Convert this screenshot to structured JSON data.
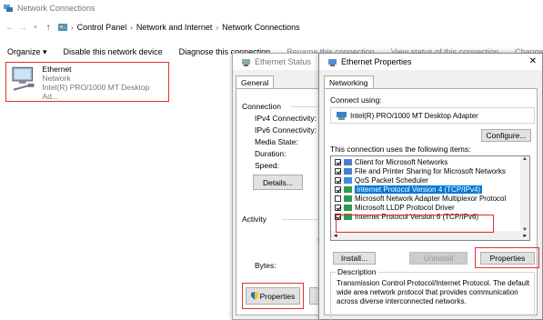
{
  "window": {
    "title": "Network Connections"
  },
  "address": {
    "crumbs": [
      "Control Panel",
      "Network and Internet",
      "Network Connections"
    ]
  },
  "command_bar": {
    "organize": "Organize ▾",
    "disable": "Disable this network device",
    "diagnose": "Diagnose this connection",
    "rename": "Rename this connection",
    "view_status": "View status of this connection",
    "change": "Change settings of this connection"
  },
  "adapter": {
    "name": "Ethernet",
    "network": "Network",
    "device": "Intel(R) PRO/1000 MT Desktop Ad..."
  },
  "status_dialog": {
    "title": "Ethernet Status",
    "tab": "General",
    "connection_label": "Connection",
    "ipv4": "IPv4 Connectivity:",
    "ipv6": "IPv6 Connectivity:",
    "media": "Media State:",
    "duration": "Duration:",
    "speed": "Speed:",
    "details_btn": "Details...",
    "activity_label": "Activity",
    "s_char": "S",
    "bytes": "Bytes:",
    "properties_btn": "Properties"
  },
  "props_dialog": {
    "title": "Ethernet Properties",
    "close": "✕",
    "tab": "Networking",
    "connect_using": "Connect using:",
    "adapter_name": "Intel(R) PRO/1000 MT Desktop Adapter",
    "configure_btn": "Configure...",
    "items_label": "This connection uses the following items:",
    "items": [
      {
        "label": "Client for Microsoft Networks",
        "checked": true,
        "selected": false
      },
      {
        "label": "File and Printer Sharing for Microsoft Networks",
        "checked": true,
        "selected": false
      },
      {
        "label": "QoS Packet Scheduler",
        "checked": true,
        "selected": false
      },
      {
        "label": "Internet Protocol Version 4 (TCP/IPv4)",
        "checked": true,
        "selected": true
      },
      {
        "label": "Microsoft Network Adapter Multiplexor Protocol",
        "checked": false,
        "selected": false
      },
      {
        "label": "Microsoft LLDP Protocol Driver",
        "checked": true,
        "selected": false
      },
      {
        "label": "Internet Protocol Version 6 (TCP/IPv6)",
        "checked": true,
        "selected": false
      }
    ],
    "install_btn": "Install...",
    "uninstall_btn": "Uninstall",
    "properties_btn": "Properties",
    "description_label": "Description",
    "description": "Transmission Control Protocol/Internet Protocol. The default wide area network protocol that provides communication across diverse interconnected networks."
  },
  "colors": {
    "highlight": "#e03030",
    "selection": "#0078d7"
  }
}
